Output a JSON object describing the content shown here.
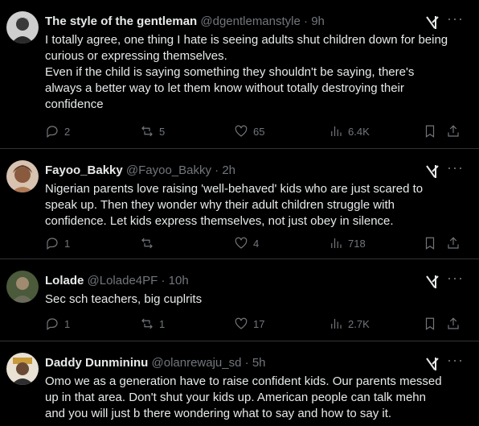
{
  "tweets": [
    {
      "name": "The style of the gentleman",
      "handle": "@dgentlemanstyle",
      "time": "9h",
      "lines": [
        "I totally agree, one thing I hate is seeing adults shut children down for being",
        "curious or expressing themselves.",
        "Even if the child is saying something they shouldn't be saying, there's",
        "always a better way to let them know without totally destroying their",
        "confidence"
      ],
      "replies": "2",
      "reposts": "5",
      "likes": "65",
      "views": "6.4K"
    },
    {
      "name": "Fayoo_Bakky",
      "handle": "@Fayoo_Bakky",
      "time": "2h",
      "lines": [
        "Nigerian parents love raising 'well-behaved' kids who are just scared to",
        "speak up. Then they wonder why their adult children struggle with",
        "confidence. Let kids express themselves, not just obey in silence."
      ],
      "replies": "1",
      "reposts": "",
      "likes": "4",
      "views": "718"
    },
    {
      "name": "Lolade",
      "handle": "@Lolade4PF",
      "time": "10h",
      "lines": [
        "Sec sch teachers, big cuplrits"
      ],
      "replies": "1",
      "reposts": "1",
      "likes": "17",
      "views": "2.7K"
    },
    {
      "name": "Daddy Dunmininu",
      "handle": "@olanrewaju_sd",
      "time": "5h",
      "lines": [
        "Omo we as a generation have to raise confident kids. Our parents messed",
        "up in that area. Don't shut your kids up. American people can talk mehn",
        "and you will just b there wondering what to say and how to say it."
      ]
    }
  ],
  "icons": {
    "reply": "reply-icon",
    "repost": "repost-icon",
    "like": "heart-icon",
    "views": "views-icon",
    "bookmark": "bookmark-icon",
    "share": "share-icon",
    "grok": "grok-icon",
    "more": "more-icon"
  },
  "colors": {
    "background": "#000000",
    "text": "#e7e9ea",
    "muted": "#71767b",
    "divider": "#2f3336"
  }
}
